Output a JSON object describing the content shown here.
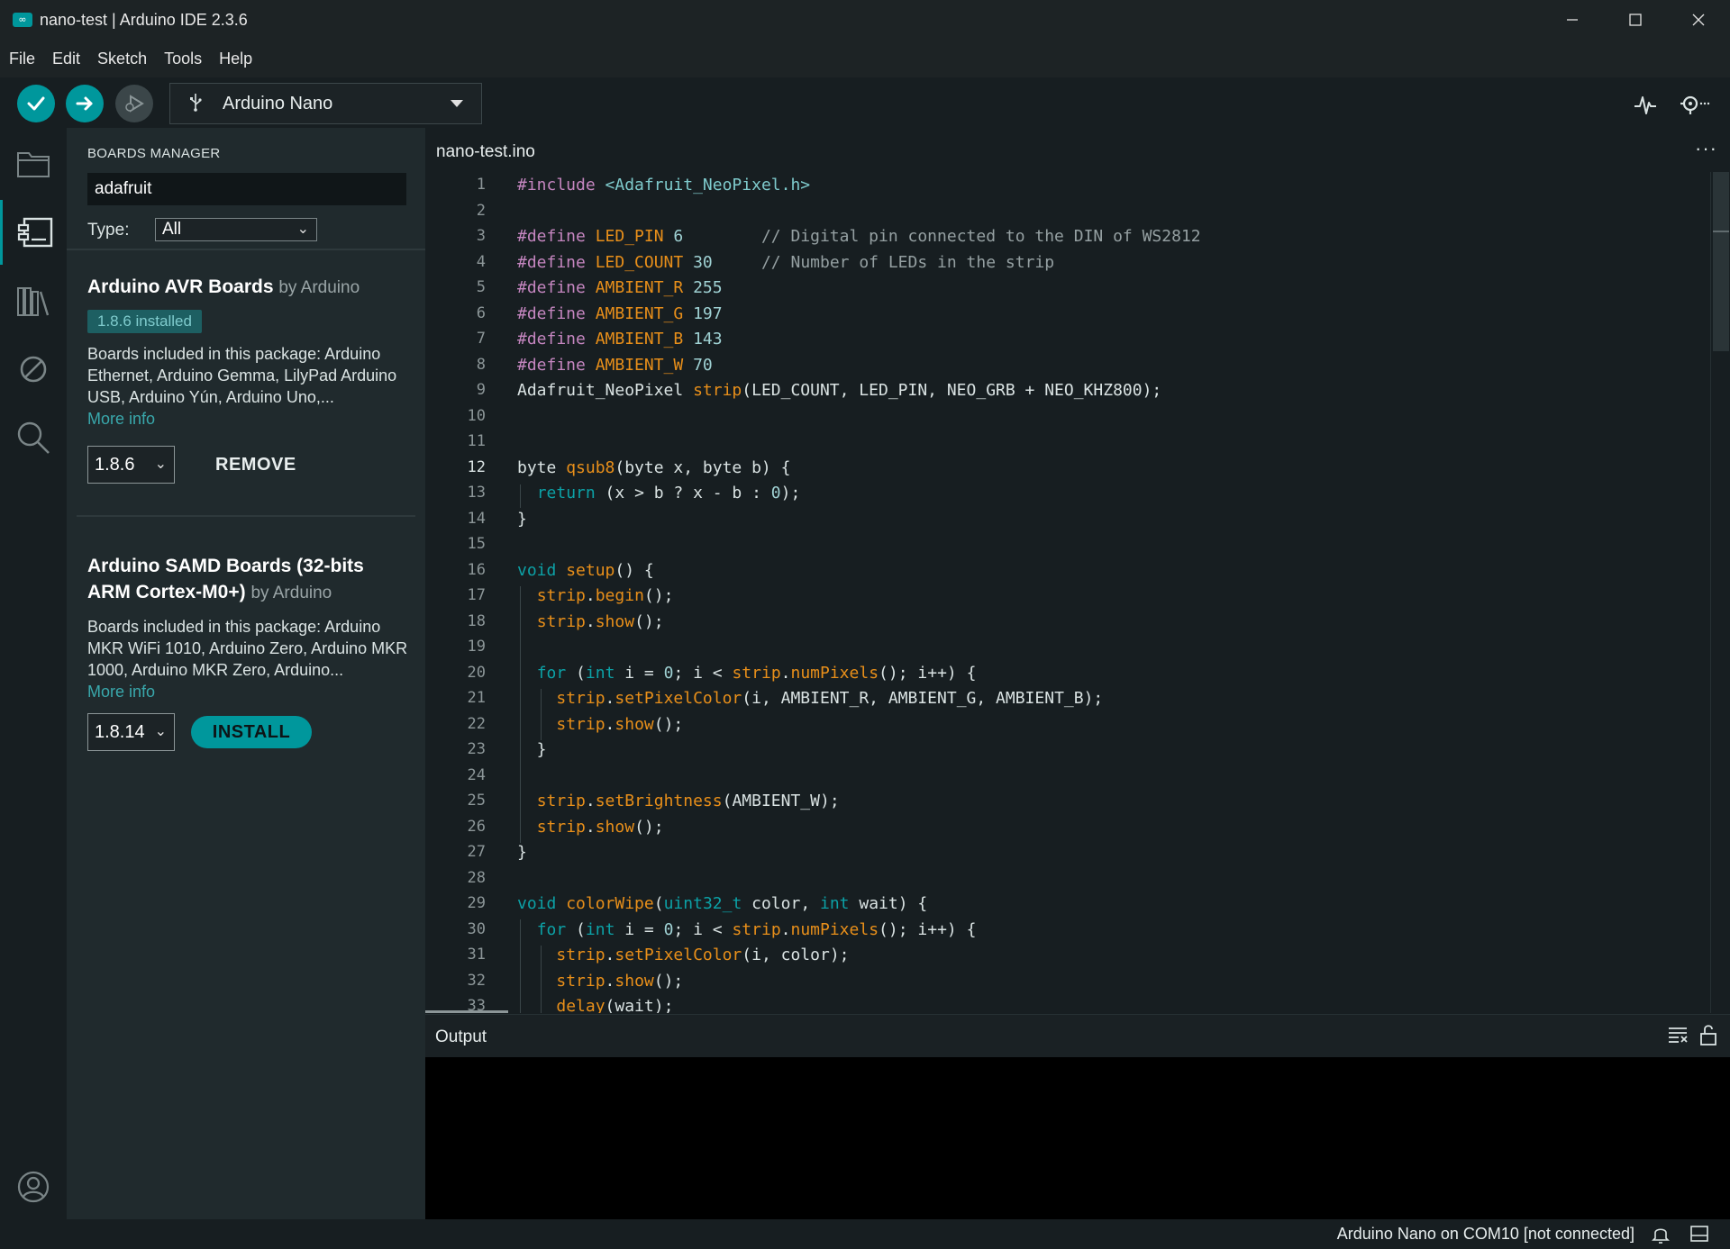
{
  "window": {
    "title": "nano-test | Arduino IDE 2.3.6",
    "app_icon": "∞",
    "controls": [
      "minimize-icon",
      "maximize-icon",
      "close-icon"
    ]
  },
  "menu": [
    "File",
    "Edit",
    "Sketch",
    "Tools",
    "Help"
  ],
  "toolbar": {
    "board": "Arduino Nano",
    "icons": [
      "verify-check-icon",
      "upload-arrow-icon",
      "debug-icon",
      "usb-icon",
      "serial-plotter-icon",
      "serial-monitor-icon"
    ]
  },
  "activity": [
    "folder-icon",
    "boards-manager-icon",
    "library-icon",
    "debug-no-icon",
    "search-icon",
    "account-icon"
  ],
  "boards_manager": {
    "title": "BOARDS MANAGER",
    "search_value": "adafruit",
    "type_label": "Type:",
    "type_value": "All",
    "boards": [
      {
        "name": "Arduino AVR Boards",
        "by": "by Arduino",
        "badge": "1.8.6 installed",
        "desc": "Boards included in this package: Arduino Ethernet, Arduino Gemma, LilyPad Arduino USB, Arduino Yún, Arduino Uno,...",
        "more": "More info",
        "version": "1.8.6",
        "action": "REMOVE"
      },
      {
        "name_line1": "Arduino SAMD Boards (32-bits",
        "name_line2": "ARM Cortex-M0+)",
        "by": "by Arduino",
        "desc": "Boards included in this package: Arduino MKR WiFi 1010, Arduino Zero, Arduino MKR 1000, Arduino MKR Zero, Arduino...",
        "more": "More info",
        "version": "1.8.14",
        "action": "INSTALL"
      }
    ]
  },
  "editor": {
    "tab": "nano-test.ino",
    "more": "···",
    "current_line": 12
  },
  "output": {
    "title": "Output"
  },
  "statusbar": {
    "status": "Arduino Nano on COM10 [not connected]"
  },
  "colors": {
    "accent": "#00979c",
    "background": "#171e21",
    "panel": "#202a2d"
  }
}
